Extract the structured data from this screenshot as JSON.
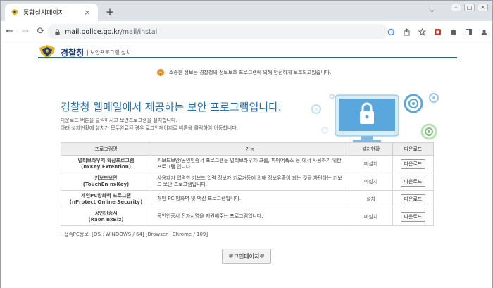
{
  "browser": {
    "tab_title": "통합설치페이지",
    "tab_close": "×",
    "new_tab": "+",
    "tab_search": "⌄",
    "window_controls": [
      "–",
      "□",
      "✕"
    ],
    "url_host": "mail.police.go.kr",
    "url_path": "/mail/install",
    "back_icon": "←",
    "forward_icon": "→",
    "reload_icon": "⟳"
  },
  "header": {
    "brand": "경찰청",
    "subtitle": "| 보안프로그램 설치"
  },
  "notice": {
    "icon": "lock-icon",
    "text": "소중한 정보는 경찰청의 정보보호 프로그램에 의해 안전하게 보호되고있습니다."
  },
  "hero": {
    "title": "경찰청 웹메일에서 제공하는 보안 프로그램입니다.",
    "line1": "다운로드 버튼을 클릭하시고 보안프로그램을 설치합니다.",
    "line2": "아래 설치현황에 설치가 모두완료된 경우 로그인페이지로 버튼을 클릭하여 이동합니다."
  },
  "table": {
    "headers": [
      "프로그램명",
      "기능",
      "설치현황",
      "다운로드"
    ],
    "rows": [
      {
        "name": "멀티브라우저 확장프로그램",
        "name_en": "(nxKey Extention)",
        "desc": "키보드보안/공인인증서 프로그램을 멀티브라우저(크롬, 파이어폭스 등)에서 사용하기 위한 프로그램 입니다.",
        "status": "미설치",
        "download": "다운로드"
      },
      {
        "name": "키보드보안",
        "name_en": "(TouchEn nxKey)",
        "desc": "사용자가 입력한 키보드 입력 정보가 키로거등에 의해 정보유출이 되는 것을 차단하는 키보드 보안 프로그램입니다.",
        "status": "미설치",
        "download": "다운로드"
      },
      {
        "name": "개인PC방화벽 프로그램",
        "name_en": "(nProtect Online Security)",
        "desc": "개인 PC 방화벽 및 백신 프로그램입니다.",
        "status": "설치",
        "download": "다운로드"
      },
      {
        "name": "공인인증서",
        "name_en": "(Raon nxBiz)",
        "desc": "공인인증서 전자서명을 지원해주는 프로그램입니다.",
        "status": "미설치",
        "download": "다운로드"
      }
    ]
  },
  "env": {
    "text": "- 접속PC정보: [OS : WINDOWS / 64] [Browser : Chrome / 109]"
  },
  "login_button": "로그인페이지로",
  "colors": {
    "brand_blue": "#1b6fb8",
    "rule_blue": "#1c62b4",
    "notice_orange": "#f58220"
  }
}
